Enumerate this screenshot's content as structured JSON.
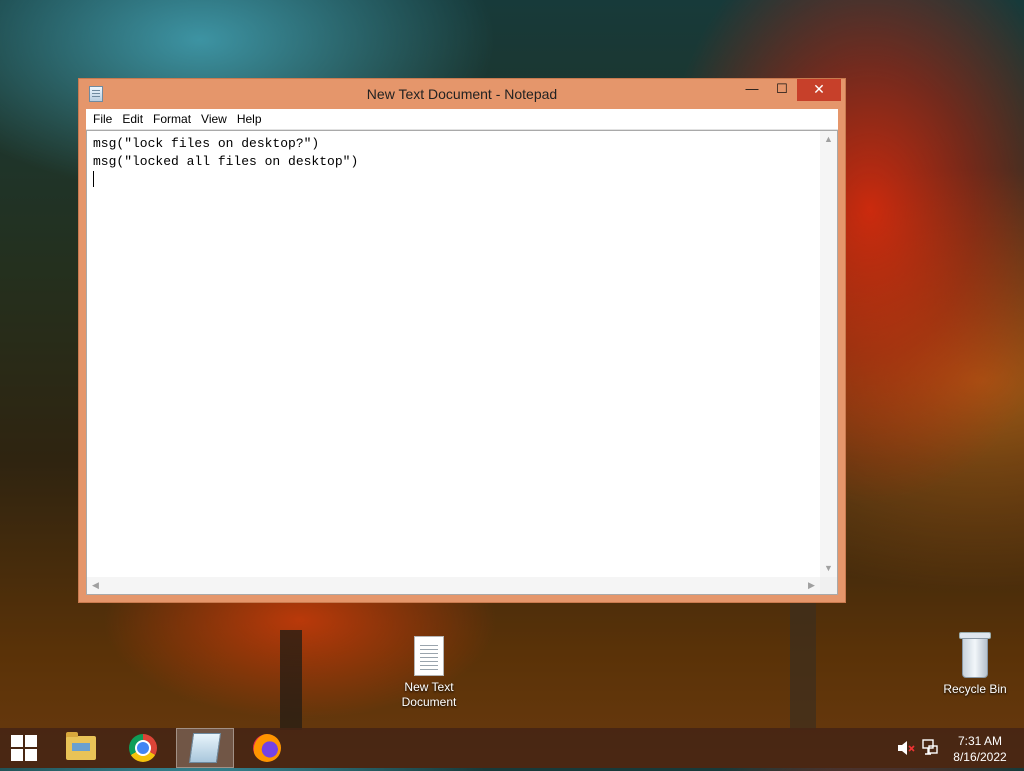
{
  "window": {
    "title": "New Text Document - Notepad",
    "controls": {
      "minimize": "—",
      "maximize": "☐",
      "close": "✕"
    }
  },
  "menu": [
    "File",
    "Edit",
    "Format",
    "View",
    "Help"
  ],
  "editor": {
    "lines": [
      "msg(\"lock files on desktop?\")",
      "msg(\"locked all files on desktop\")"
    ]
  },
  "desktop": {
    "icons": [
      {
        "label_line1": "New Text",
        "label_line2": "Document",
        "icon": "text-document-icon"
      },
      {
        "label_line1": "Recycle Bin",
        "icon": "recycle-bin-icon"
      }
    ]
  },
  "taskbar": {
    "apps": [
      "start-icon",
      "file-explorer-icon",
      "chrome-icon",
      "notepad-icon",
      "firefox-icon"
    ],
    "clock": {
      "time": "7:31 AM",
      "date": "8/16/2022"
    },
    "tray_icons": [
      "speaker-muted-icon",
      "network-icon"
    ]
  }
}
